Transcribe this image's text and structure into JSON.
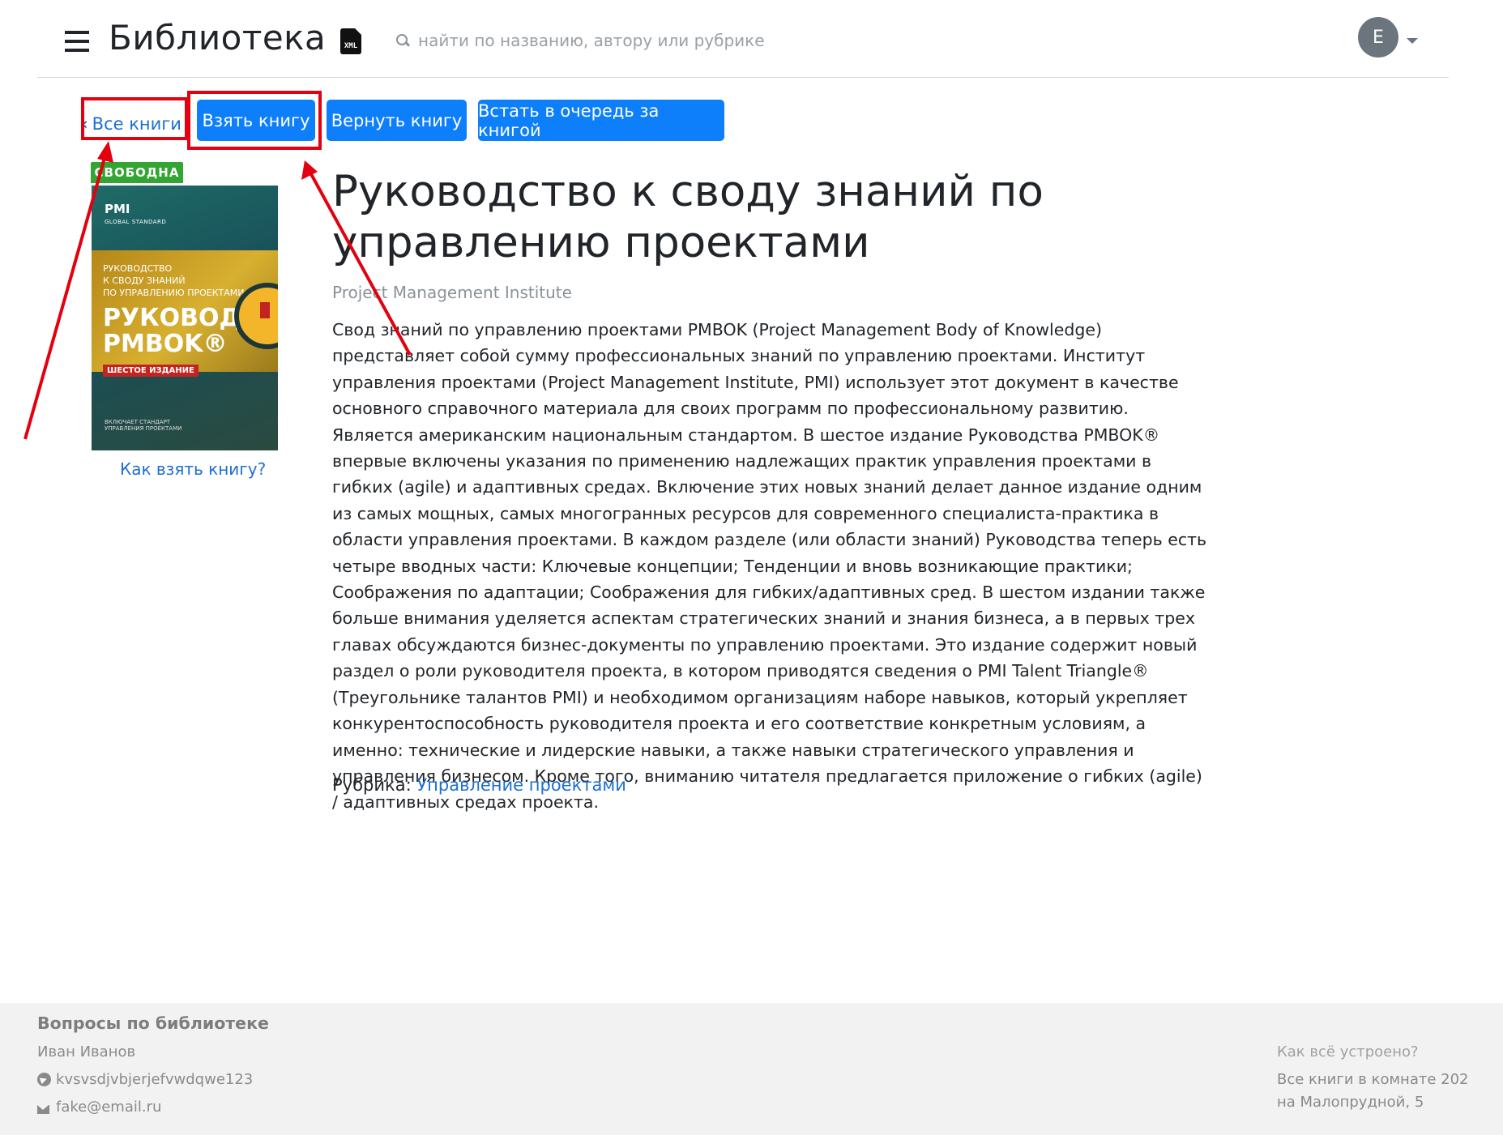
{
  "header": {
    "app_title": "Библиотека",
    "xml_label": "XML",
    "search_placeholder": "найти по названию, автору или рубрике",
    "avatar_initial": "E"
  },
  "actions": {
    "back_chevron": "‹",
    "back_label": "Все книги",
    "take_label": "Взять книгу",
    "return_label": "Вернуть книгу",
    "queue_label": "Встать в очередь за книгой"
  },
  "book": {
    "status": "СВОБОДНА",
    "cover": {
      "publisher": "PMI",
      "publisher_sub": "GLOBAL STANDARD",
      "subtitle_lines": "РУКОВОДСТВО\nК СВОДУ ЗНАНИЙ\nПО УПРАВЛЕНИЮ ПРОЕКТАМИ",
      "title": "РУКОВОДСТВО\nPMBOK®",
      "edition": "ШЕСТОЕ ИЗДАНИЕ",
      "footer": "ВКЛЮЧАЕТ СТАНДАРТ\nУПРАВЛЕНИЯ ПРОЕКТАМИ"
    },
    "how_to_take": "Как взять книгу?",
    "title": "Руководство к своду знаний по управлению проектами",
    "author": "Project Management Institute",
    "description": "Свод знаний по управлению проектами PMBOK (Project Management Body of Knowledge) представляет собой сумму профессиональных знаний по управлению проектами. Институт управления проектами (Project Management Institute, PMI) использует этот документ в качестве основного справочного материала для своих программ по профессиональному развитию. Является американским национальным стандартом. В шестое издание Руководства PMBOK® впервые включены указания по применению надлежащих практик управления проектами в гибких (agile) и адаптивных средах. Включение этих новых знаний делает данное издание одним из самых мощных, самых многогранных ресурсов для современного специалиста-практика в области управления проектами. В каждом разделе (или области знаний) Руководства теперь есть четыре вводных части: Ключевые концепции; Тенденции и вновь возникающие практики; Соображения по адаптации; Соображения для гибких/адаптивных сред. В шестом издании также больше внимания уделяется аспектам стратегических знаний и знания бизнеса, а в первых трех главах обсуждаются бизнес-документы по управлению проектами. Это издание содержит новый раздел о роли руководителя проекта, в котором приводятся сведения о PMI Talent Triangle® (Треугольнике талантов PMI) и необходимом организациям наборе навыков, который укрепляет конкурентоспособность руководителя проекта и его соответствие конкретным условиям, а именно: технические и лидерские навыки, а также навыки стратегического управления и управления бизнесом. Кроме того, вниманию читателя предлагается приложение о гибких (agile) / адаптивных средах проекта.",
    "category_label": "Рубрика:",
    "category_value": "Управление проектами"
  },
  "footer": {
    "title": "Вопросы по библиотеке",
    "contact_name": "Иван Иванов",
    "telegram": "kvsvsdjvbjerjefvwdqwe123",
    "email": "fake@email.ru",
    "how_it_works": "Как всё устроено?",
    "location_line1": "Все книги в комнате 202",
    "location_line2": "на Малопрудной, 5"
  },
  "colors": {
    "primary": "#0d7ffa",
    "link": "#1d6fd1",
    "badge": "#33a532",
    "annotation": "#e3000f"
  }
}
